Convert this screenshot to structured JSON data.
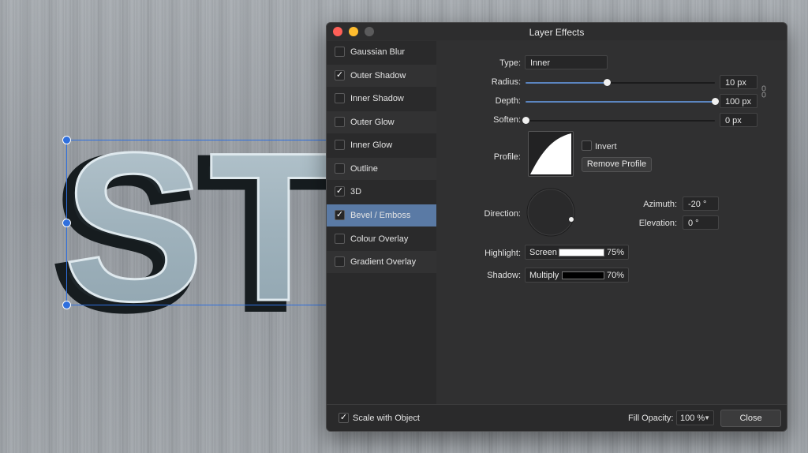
{
  "window": {
    "title": "Layer Effects"
  },
  "artwork": {
    "text": "ST"
  },
  "effects": {
    "items": [
      {
        "label": "Gaussian Blur",
        "checked": false,
        "selected": false
      },
      {
        "label": "Outer Shadow",
        "checked": true,
        "selected": false
      },
      {
        "label": "Inner Shadow",
        "checked": false,
        "selected": false
      },
      {
        "label": "Outer Glow",
        "checked": false,
        "selected": false
      },
      {
        "label": "Inner Glow",
        "checked": false,
        "selected": false
      },
      {
        "label": "Outline",
        "checked": false,
        "selected": false
      },
      {
        "label": "3D",
        "checked": true,
        "selected": false
      },
      {
        "label": "Bevel / Emboss",
        "checked": true,
        "selected": true
      },
      {
        "label": "Colour Overlay",
        "checked": false,
        "selected": false
      },
      {
        "label": "Gradient Overlay",
        "checked": false,
        "selected": false
      }
    ]
  },
  "settings": {
    "type_label": "Type:",
    "type_value": "Inner",
    "radius_label": "Radius:",
    "radius_value": "10 px",
    "radius_fraction": 0.43,
    "depth_label": "Depth:",
    "depth_value": "100 px",
    "depth_fraction": 1.0,
    "soften_label": "Soften:",
    "soften_value": "0 px",
    "soften_fraction": 0.0,
    "profile_label": "Profile:",
    "invert_label": "Invert",
    "invert_checked": false,
    "remove_profile_label": "Remove Profile",
    "direction_label": "Direction:",
    "azimuth_label": "Azimuth:",
    "azimuth_value": "-20 °",
    "elevation_label": "Elevation:",
    "elevation_value": "0 °",
    "highlight_label": "Highlight:",
    "highlight_mode": "Screen",
    "highlight_color": "#ffffff",
    "highlight_opacity": "75%",
    "shadow_label": "Shadow:",
    "shadow_mode": "Multiply",
    "shadow_color": "#000000",
    "shadow_opacity": "70%"
  },
  "footer": {
    "scale_label": "Scale with Object",
    "scale_checked": true,
    "fill_opacity_label": "Fill Opacity:",
    "fill_opacity_value": "100 %",
    "close_label": "Close"
  },
  "colors": {
    "selection_accent": "#5a7aa5",
    "slider_fill": "#5b85c0",
    "handle": "#2f6fdd"
  }
}
